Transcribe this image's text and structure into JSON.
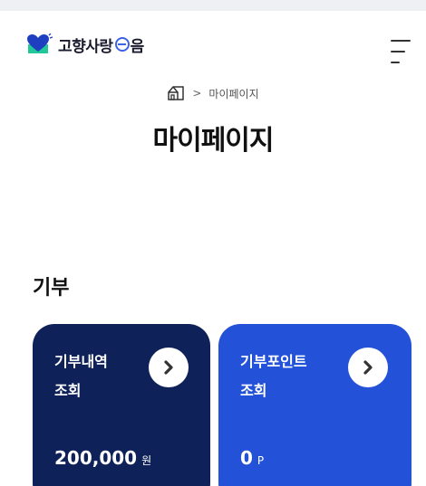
{
  "header": {
    "logo_text_prefix": "고향사랑",
    "logo_text_suffix": "음",
    "menu_icon": "hamburger-menu-icon"
  },
  "breadcrumb": {
    "home_icon": "home-icon",
    "separator": ">",
    "current": "마이페이지"
  },
  "page": {
    "title": "마이페이지"
  },
  "donation": {
    "section_title": "기부",
    "cards": [
      {
        "label_line1": "기부내역",
        "label_line2": "조회",
        "amount": "200,000",
        "unit": "원",
        "color": "#0e2158"
      },
      {
        "label_line1": "기부포인트",
        "label_line2": "조회",
        "amount": "0",
        "unit": "P",
        "color": "#2352d9"
      }
    ]
  },
  "colors": {
    "accent_blue": "#3b63e6",
    "heart": "#1e3fbf",
    "envelope": "#20c997",
    "card_navy": "#0e2158",
    "card_blue": "#2352d9"
  }
}
